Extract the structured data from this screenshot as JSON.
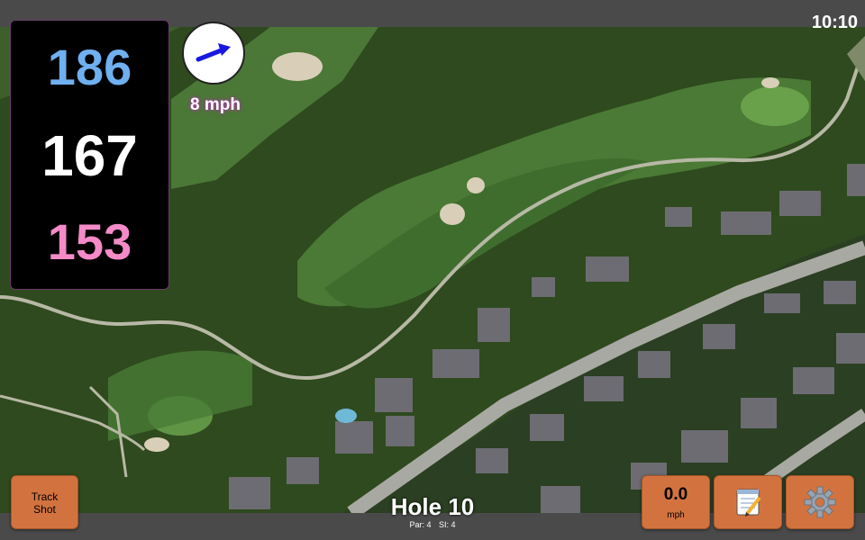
{
  "status": {
    "time": "10:10"
  },
  "distances": {
    "back": "186",
    "center": "167",
    "front": "153"
  },
  "wind": {
    "speed_label": "8 mph",
    "direction_icon": "wind-arrow-icon"
  },
  "hole": {
    "title": "Hole 10",
    "par": "Par: 4",
    "si": "SI: 4"
  },
  "buttons": {
    "track_shot_line1": "Track",
    "track_shot_line2": "Shot",
    "wind_value": "0.0",
    "wind_unit": "mph",
    "notes_icon": "notepad-icon",
    "settings_icon": "gear-icon"
  },
  "colors": {
    "back_distance": "#6fb0f0",
    "center_distance": "#ffffff",
    "front_distance": "#f48ac8",
    "button": "#d2733f",
    "wind_arrow": "#1818e0"
  }
}
